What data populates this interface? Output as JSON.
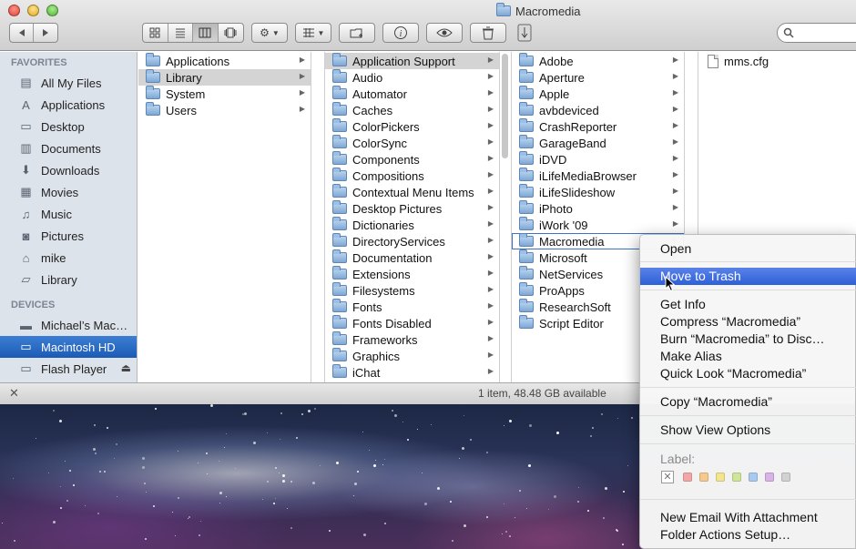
{
  "window": {
    "title": "Macromedia"
  },
  "toolbar": {
    "search_placeholder": ""
  },
  "sidebar": {
    "favorites_header": "FAVORITES",
    "favorites": [
      {
        "label": "All My Files",
        "icon": "all-files-icon"
      },
      {
        "label": "Applications",
        "icon": "applications-icon"
      },
      {
        "label": "Desktop",
        "icon": "desktop-icon"
      },
      {
        "label": "Documents",
        "icon": "documents-icon"
      },
      {
        "label": "Downloads",
        "icon": "downloads-icon"
      },
      {
        "label": "Movies",
        "icon": "movies-icon"
      },
      {
        "label": "Music",
        "icon": "music-icon"
      },
      {
        "label": "Pictures",
        "icon": "pictures-icon"
      },
      {
        "label": "mike",
        "icon": "home-icon"
      },
      {
        "label": "Library",
        "icon": "folder-icon"
      }
    ],
    "devices_header": "DEVICES",
    "devices": [
      {
        "label": "Michael’s Mac…",
        "icon": "computer-icon"
      },
      {
        "label": "Macintosh HD",
        "icon": "hard-disk-icon"
      },
      {
        "label": "Flash Player",
        "icon": "disk-image-icon"
      }
    ]
  },
  "columns": {
    "col1": [
      "Applications",
      "Library",
      "System",
      "Users"
    ],
    "col2": [
      "Application Support",
      "Audio",
      "Automator",
      "Caches",
      "ColorPickers",
      "ColorSync",
      "Components",
      "Compositions",
      "Contextual Menu Items",
      "Desktop Pictures",
      "Dictionaries",
      "DirectoryServices",
      "Documentation",
      "Extensions",
      "Filesystems",
      "Fonts",
      "Fonts Disabled",
      "Frameworks",
      "Graphics",
      "iChat"
    ],
    "col3": [
      "Adobe",
      "Aperture",
      "Apple",
      "avbdeviced",
      "CrashReporter",
      "GarageBand",
      "iDVD",
      "iLifeMediaBrowser",
      "iLifeSlideshow",
      "iPhoto",
      "iWork '09",
      "Macromedia",
      "Microsoft",
      "NetServices",
      "ProApps",
      "ResearchSoft",
      "Script Editor"
    ],
    "col4": [
      "mms.cfg"
    ]
  },
  "status": {
    "text": "1 item, 48.48 GB available"
  },
  "context_menu": {
    "open": "Open",
    "move_to_trash": "Move to Trash",
    "get_info": "Get Info",
    "compress": "Compress “Macromedia”",
    "burn": "Burn “Macromedia” to Disc…",
    "make_alias": "Make Alias",
    "quick_look": "Quick Look “Macromedia”",
    "copy": "Copy “Macromedia”",
    "show_view_options": "Show View Options",
    "label_header": "Label:",
    "new_email": "New Email With Attachment",
    "folder_actions": "Folder Actions Setup…",
    "label_colors": [
      "#f2a7a7",
      "#f5c98f",
      "#f2e58e",
      "#cfe59a",
      "#a9c9ef",
      "#d7b3e6",
      "#d2d2d2"
    ]
  }
}
